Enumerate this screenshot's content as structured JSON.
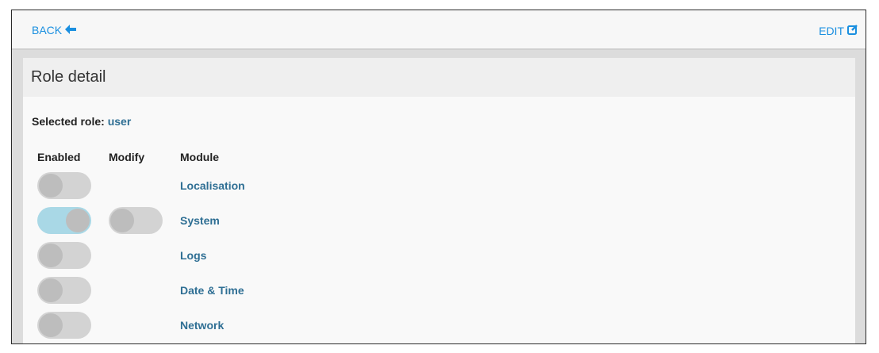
{
  "header": {
    "back_label": "BACK",
    "back_icon": "arrow-left-icon",
    "edit_label": "EDIT",
    "edit_icon": "edit-icon",
    "link_color": "#1a8fe0"
  },
  "panel": {
    "title": "Role detail",
    "selected_role_label": "Selected role:",
    "selected_role_value": "user"
  },
  "table": {
    "columns": [
      "Enabled",
      "Modify",
      "Module"
    ],
    "rows": [
      {
        "module": "Localisation",
        "enabled": false,
        "modify": null
      },
      {
        "module": "System",
        "enabled": true,
        "modify": false
      },
      {
        "module": "Logs",
        "enabled": false,
        "modify": null
      },
      {
        "module": "Date & Time",
        "enabled": false,
        "modify": null
      },
      {
        "module": "Network",
        "enabled": false,
        "modify": null
      }
    ]
  },
  "colors": {
    "toggle_on": "#a9d8e6",
    "toggle_off": "#d3d3d3",
    "module_text": "#2f6f94"
  }
}
